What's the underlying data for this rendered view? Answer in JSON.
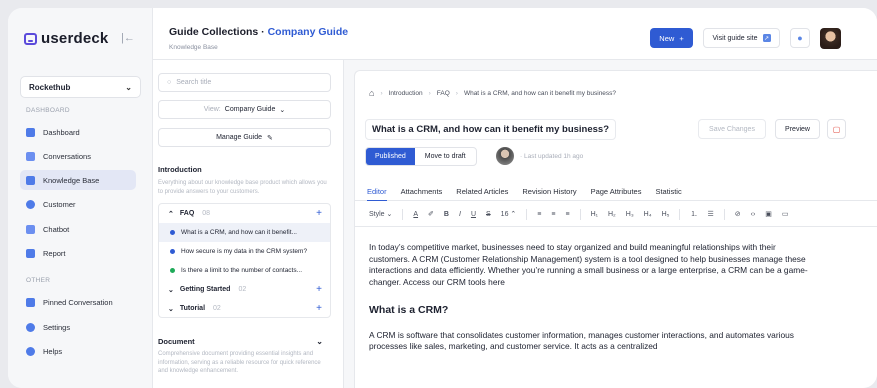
{
  "sidebar": {
    "brand": "userdeck",
    "workspace": "Rockethub",
    "dashboard_section": "DASHBOARD",
    "items": [
      {
        "label": "Dashboard",
        "icon": "grid-icon",
        "color": "#4f7be8"
      },
      {
        "label": "Conversations",
        "icon": "chat-icon",
        "color": "#6c8ff0"
      },
      {
        "label": "Knowledge Base",
        "icon": "book-icon",
        "color": "#4f7be8",
        "active": true
      },
      {
        "label": "Customer",
        "icon": "users-icon",
        "color": "#4f7be8"
      },
      {
        "label": "Chatbot",
        "icon": "bot-icon",
        "color": "#6c8ff0"
      },
      {
        "label": "Report",
        "icon": "chart-icon",
        "color": "#4f7be8"
      }
    ],
    "other_section": "OTHER",
    "other_items": [
      {
        "label": "Pinned Conversation",
        "icon": "pin-icon",
        "color": "#4f7be8"
      },
      {
        "label": "Settings",
        "icon": "gear-icon",
        "color": "#4f7be8"
      },
      {
        "label": "Helps",
        "icon": "help-icon",
        "color": "#4f7be8"
      }
    ]
  },
  "header": {
    "title_prefix": "Guide Collections · ",
    "title_accent": "Company Guide",
    "subtitle": "Knowledge Base",
    "new_label": "New",
    "visit_label": "Visit guide site"
  },
  "middle": {
    "search_placeholder": "Search title",
    "view_label": "View:",
    "view_value": "Company Guide",
    "manage_label": "Manage Guide",
    "intro_title": "Introduction",
    "intro_desc": "Everything about our knowledge base product which allows you to provide answers to your customers.",
    "folders": [
      {
        "name": "FAQ",
        "count": "08",
        "expanded": true,
        "children": [
          {
            "label": "What is a CRM, and how can it benefit...",
            "color": "#2f5bd3",
            "selected": true
          },
          {
            "label": "How secure is my data in the CRM system?",
            "color": "#2f5bd3"
          },
          {
            "label": "Is there a limit to the number of contacts...",
            "color": "#1faa59"
          }
        ]
      },
      {
        "name": "Getting Started",
        "count": "02"
      },
      {
        "name": "Tutorial",
        "count": "02"
      }
    ],
    "doc_title": "Document",
    "doc_desc": "Comprehensive document providing essential insights and information, serving as a reliable resource for quick reference and knowledge enhancement."
  },
  "editor": {
    "breadcrumb": [
      "Introduction",
      "FAQ",
      "What is a CRM, and how can it benefit my business?"
    ],
    "title": "What is a CRM, and how can it benefit my business?",
    "save_label": "Save Changes",
    "preview_label": "Preview",
    "published_label": "Published",
    "draft_label": "Move to draft",
    "updated": "· Last updated 1h ago",
    "tabs": [
      "Editor",
      "Attachments",
      "Related Articles",
      "Revision History",
      "Page Attributes",
      "Statistic"
    ],
    "toolbar": {
      "style": "Style",
      "font_size": "16"
    },
    "para1": "In today’s competitive market, businesses need to stay organized and build meaningful relationships with their customers. A CRM (Customer Relationship Management) system is a tool designed to help businesses manage these interactions and data efficiently. Whether you’re running a small business or a large enterprise, a CRM can be a game-changer. Access our CRM tools here",
    "heading": "What is a CRM?",
    "para2": "A CRM is software that consolidates customer information, manages customer interactions, and automates various processes like sales, marketing, and customer service. It acts as a centralized"
  }
}
